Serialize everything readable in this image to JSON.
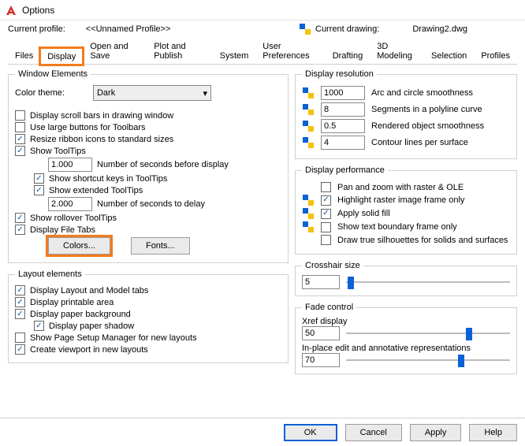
{
  "window": {
    "title": "Options"
  },
  "profile": {
    "label": "Current profile:",
    "value": "<<Unnamed Profile>>",
    "drawing_label": "Current drawing:",
    "drawing_value": "Drawing2.dwg"
  },
  "tabs": [
    "Files",
    "Display",
    "Open and Save",
    "Plot and Publish",
    "System",
    "User Preferences",
    "Drafting",
    "3D Modeling",
    "Selection",
    "Profiles"
  ],
  "win_elem": {
    "legend": "Window Elements",
    "color_theme_label": "Color theme:",
    "color_theme_value": "Dark",
    "scroll_bars": "Display scroll bars in drawing window",
    "large_buttons": "Use large buttons for Toolbars",
    "resize_ribbon": "Resize ribbon icons to standard sizes",
    "show_tooltips": "Show ToolTips",
    "tt_seconds_value": "1.000",
    "tt_seconds_label": "Number of seconds before display",
    "shortcut_keys": "Show shortcut keys in ToolTips",
    "extended_tt": "Show extended ToolTips",
    "ext_seconds_value": "2.000",
    "ext_seconds_label": "Number of seconds to delay",
    "rollover_tt": "Show rollover ToolTips",
    "file_tabs": "Display File Tabs",
    "colors_btn": "Colors...",
    "fonts_btn": "Fonts..."
  },
  "layout": {
    "legend": "Layout elements",
    "lm_tabs": "Display Layout and Model tabs",
    "printable": "Display printable area",
    "paper_bg": "Display paper background",
    "paper_shadow": "Display paper shadow",
    "page_setup": "Show Page Setup Manager for new layouts",
    "viewport": "Create viewport in new layouts"
  },
  "resolution": {
    "legend": "Display resolution",
    "arc_value": "1000",
    "arc_label": "Arc and circle smoothness",
    "seg_value": "8",
    "seg_label": "Segments in a polyline curve",
    "rend_value": "0.5",
    "rend_label": "Rendered object smoothness",
    "contour_value": "4",
    "contour_label": "Contour lines per surface"
  },
  "perf": {
    "legend": "Display performance",
    "pan_zoom": "Pan and zoom with raster & OLE",
    "hl_raster": "Highlight raster image frame only",
    "solid_fill": "Apply solid fill",
    "text_boundary": "Show text boundary frame only",
    "true_silhouettes": "Draw true silhouettes for solids and surfaces"
  },
  "crosshair": {
    "legend": "Crosshair size",
    "value": "5",
    "pct": 3
  },
  "fade": {
    "legend": "Fade control",
    "xref_label": "Xref display",
    "xref_value": "50",
    "xref_pct": 75,
    "inplace_label": "In-place edit and annotative representations",
    "inplace_value": "70",
    "inplace_pct": 70
  },
  "buttons": {
    "ok": "OK",
    "cancel": "Cancel",
    "apply": "Apply",
    "help": "Help"
  }
}
